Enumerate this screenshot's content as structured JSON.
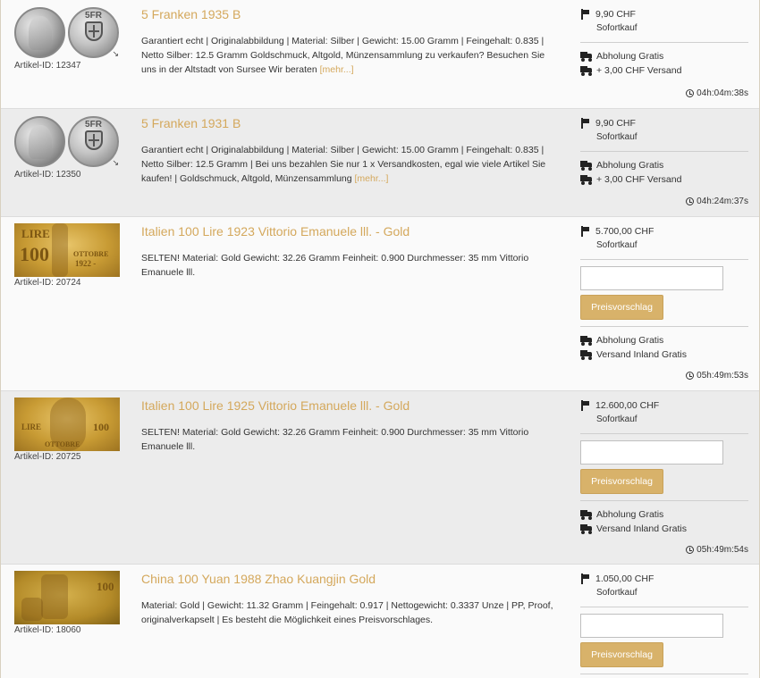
{
  "listings": [
    {
      "title": "5 Franken 1935 B",
      "article_id": "Artikel-ID: 12347",
      "desc": "Garantiert echt | Originalabbildung | Material: Silber | Gewicht: 15.00 Gramm | Feingehalt: 0.835 | Netto Silber: 12.5 Gramm Goldschmuck, Altgold, Münzensammlung zu verkaufen?  Besuchen Sie uns in der Altstadt von Sursee  Wir beraten",
      "more": "[mehr...]",
      "price": "9,90 CHF",
      "price_type": "Sofortkauf",
      "pickup": "Abholung Gratis",
      "shipping": "+ 3,00 CHF Versand",
      "time_left": "04h:04m:38s",
      "coin_back_text": "5FR"
    },
    {
      "title": "5 Franken 1931 B",
      "article_id": "Artikel-ID: 12350",
      "desc": "Garantiert echt | Originalabbildung | Material: Silber | Gewicht: 15.00 Gramm | Feingehalt: 0.835 | Netto Silber: 12.5 Gramm | Bei uns bezahlen Sie nur 1 x Versandkosten, egal wie viele Artikel Sie kaufen! | Goldschmuck, Altgold, Münzensammlung",
      "more": "[mehr...]",
      "price": "9,90 CHF",
      "price_type": "Sofortkauf",
      "pickup": "Abholung Gratis",
      "shipping": "+ 3,00 CHF Versand",
      "time_left": "04h:24m:37s",
      "coin_back_text": "5FR"
    },
    {
      "title": "Italien 100 Lire 1923 Vittorio Emanuele lll. - Gold",
      "article_id": "Artikel-ID: 20724",
      "desc": "SELTEN!  Material: Gold Gewicht: 32.26 Gramm Feinheit: 0.900 Durchmesser: 35 mm Vittorio Emanuele lll.",
      "price": "5.700,00 CHF",
      "price_type": "Sofortkauf",
      "offer_button": "Preisvorschlag",
      "pickup": "Abholung Gratis",
      "shipping": "Versand Inland Gratis",
      "time_left": "05h:49m:53s",
      "img_text_1": "LIRE",
      "img_text_2": "100",
      "img_text_3": "OTTOBRE",
      "img_text_4": "1922 -"
    },
    {
      "title": "Italien 100 Lire 1925 Vittorio Emanuele lll. - Gold",
      "article_id": "Artikel-ID: 20725",
      "desc": "SELTEN!  Material: Gold Gewicht: 32.26 Gramm Feinheit: 0.900 Durchmesser: 35 mm Vittorio Emanuele lll.",
      "price": "12.600,00 CHF",
      "price_type": "Sofortkauf",
      "offer_button": "Preisvorschlag",
      "pickup": "Abholung Gratis",
      "shipping": "Versand Inland Gratis",
      "time_left": "05h:49m:54s",
      "img_text_1": "LIRE",
      "img_text_2": "100",
      "img_text_3": "OTTOBRE"
    },
    {
      "title": "China 100 Yuan 1988 Zhao Kuangjin Gold",
      "article_id": "Artikel-ID: 18060",
      "desc": "Material: Gold | Gewicht: 11.32 Gramm | Feingehalt: 0.917 | Nettogewicht: 0.3337 Unze | PP, Proof, originalverkapselt | Es besteht die Möglichkeit eines Preisvorschlages.",
      "price": "1.050,00 CHF",
      "price_type": "Sofortkauf",
      "offer_button": "Preisvorschlag",
      "img_text_1": "100"
    }
  ],
  "colors": {
    "accent_gold": "#d4a85c",
    "button_gold": "#d8b26a",
    "row_alt": "#ececec"
  }
}
